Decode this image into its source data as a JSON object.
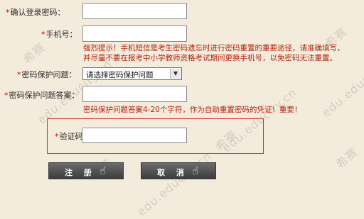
{
  "form": {
    "confirm_password": {
      "label": "确认登录密码："
    },
    "phone": {
      "label": "手机号：",
      "hint_line1": "强烈提示！手机短信是考生密码遗忘时进行密码重置的重要途径，请准确填写，",
      "hint_line2": "并尽量不要在报考中小学教师资格考试期间更换手机号，以免密码无法重置。"
    },
    "security_question": {
      "label": "密码保护问题：",
      "selected": "请选择密码保护问题"
    },
    "security_answer": {
      "label": "密码保护问题答案：",
      "hint": "密码保护问题答案4-20个字符，作为自助重置密码的凭证！重要！"
    },
    "captcha": {
      "label": "验证码"
    },
    "required_mark": "*"
  },
  "buttons": {
    "register": "注 册",
    "cancel": "取 消"
  },
  "watermark": {
    "brand": "希赛",
    "domain": "edu.educity.cn"
  },
  "colors": {
    "hint": "#b5220f",
    "highlight": "#d9302a",
    "background": "#f3ecdc"
  },
  "icons": {
    "cursor": "hand-pointer-icon",
    "dropdown": "chevron-down-icon"
  }
}
